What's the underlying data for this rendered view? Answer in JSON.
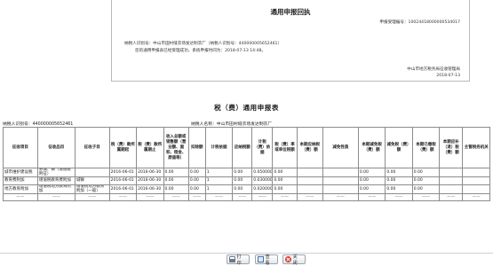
{
  "receipt": {
    "title": "通用申报回执",
    "number": "申报受理编号：10024418000000534017",
    "line1": "纳税人识别号：中山市田村缝衣场发达制衣厂（纳税人识别号：440000005652461）",
    "line2": "您的通用申报表已经受理成功，系统申报时间为：2018-07-13 14:48。",
    "org": "中山市地方税务局征收管理局",
    "date": "2018-07-13"
  },
  "form": {
    "title": "税（费）通用申报表",
    "taxpayer_id": "纳税人识别号：440000005652461",
    "taxpayer_name": "纳税人名称：中山市田村缝衣场发达制衣厂"
  },
  "table": {
    "headers": [
      "征收项目",
      "征收品目",
      "征收子目",
      "税（费）款所属期起",
      "税（费）款所属期止",
      "收入总额或销售额（营业额、面积、租金、原值等）",
      "扣除额",
      "计税依据",
      "应纳税额",
      "计税（费）依据",
      "税（费）率或单位税额",
      "本期应纳税（费）额",
      "减免性质",
      "本期减免税（费）额",
      "减免税（费）额",
      "本期已缴税（费）额",
      "本期应补（退）税（费）额",
      "主管税务机关"
    ],
    "rows": [
      [
        "城市维护建设税",
        "县城、镇（增值税附征）",
        "",
        "2016-06-01",
        "2016-06-30",
        "0.00",
        "0.00",
        "1",
        "0.00",
        "0.050000",
        "0.00",
        "",
        "",
        "0.00",
        "0.00",
        "0.00",
        "",
        ""
      ],
      [
        "教育费附加",
        "增值税教育费附加",
        "城镇",
        "2016-06-01",
        "2016-06-30",
        "0.00",
        "0.00",
        "1",
        "0.00",
        "0.030000",
        "0.00",
        "",
        "",
        "0.00",
        "0.00",
        "0.00",
        "",
        ""
      ],
      [
        "地方教育附加",
        "增值税地方教育附加",
        "增值税地方教育附加（一般）",
        "2016-06-01",
        "2016-06-30",
        "0.00",
        "0.00",
        "1",
        "0.00",
        "0.020000",
        "0.00",
        "",
        "",
        "0.00",
        "0.00",
        "0.00",
        "",
        ""
      ],
      [
        "——",
        "——",
        "——",
        "——",
        "——",
        "——",
        "——",
        "——",
        "——",
        "——",
        "——",
        "——",
        "——",
        "——",
        "——",
        "——",
        "——",
        "——"
      ]
    ]
  },
  "toolbar": {
    "print_label": "打印",
    "view_label": "查看",
    "close_label": "关闭",
    "print_icon": "print-icon",
    "view_icon": "view-icon",
    "close_icon": "close-icon"
  }
}
